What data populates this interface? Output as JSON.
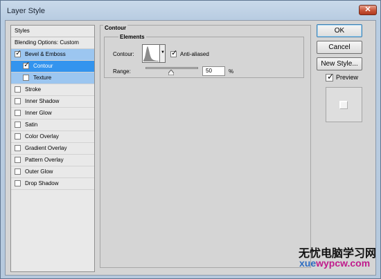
{
  "window": {
    "title": "Layer Style"
  },
  "styles": {
    "header": "Styles",
    "items": [
      {
        "label": "Blending Options: Custom",
        "checked": null
      },
      {
        "label": "Bevel & Emboss",
        "checked": true
      },
      {
        "label": "Contour",
        "checked": true
      },
      {
        "label": "Texture",
        "checked": false
      },
      {
        "label": "Stroke",
        "checked": false
      },
      {
        "label": "Inner Shadow",
        "checked": false
      },
      {
        "label": "Inner Glow",
        "checked": false
      },
      {
        "label": "Satin",
        "checked": false
      },
      {
        "label": "Color Overlay",
        "checked": false
      },
      {
        "label": "Gradient Overlay",
        "checked": false
      },
      {
        "label": "Pattern Overlay",
        "checked": false
      },
      {
        "label": "Outer Glow",
        "checked": false
      },
      {
        "label": "Drop Shadow",
        "checked": false
      }
    ]
  },
  "contour": {
    "group_title": "Contour",
    "elements_title": "Elements",
    "contour_label": "Contour:",
    "antialiased_label": "Anti-aliased",
    "antialiased_checked": true,
    "range_label": "Range:",
    "range_value": "50",
    "range_unit": "%",
    "range_fraction": 0.5
  },
  "buttons": {
    "ok": "OK",
    "cancel": "Cancel",
    "new_style": "New Style..."
  },
  "preview": {
    "label": "Preview",
    "checked": true
  },
  "watermark": {
    "chinese": "无忧电脑学习网",
    "url": "wypcw.com",
    "url_prefix": "xue"
  },
  "colors": {
    "selected_row": "#3394ee",
    "highlight_row": "#9cc6f0",
    "close_button": "#c8553a"
  }
}
